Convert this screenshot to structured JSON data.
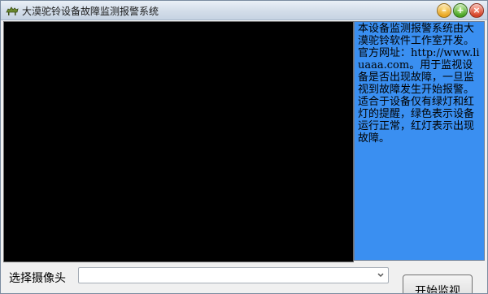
{
  "window": {
    "title": "大漠驼铃设备故障监测报警系统",
    "controls": {
      "minimize": "–",
      "maximize": "+",
      "close": "×"
    }
  },
  "video": {
    "background": "#000000"
  },
  "info_panel": {
    "background": "#3a8ff1",
    "text": "本设备监测报警系统由大漠驼铃软件工作室开发。官方网址：http://www.liuaaa.com。用于监视设备是否出现故障，一旦监视到故障发生开始报警。适合于设备仅有绿灯和红灯的提醒，绿色表示设备运行正常，红灯表示出现故障。"
  },
  "camera": {
    "label": "选择摄像头",
    "selected_value": ""
  },
  "start_button": {
    "label": "开始监视"
  }
}
